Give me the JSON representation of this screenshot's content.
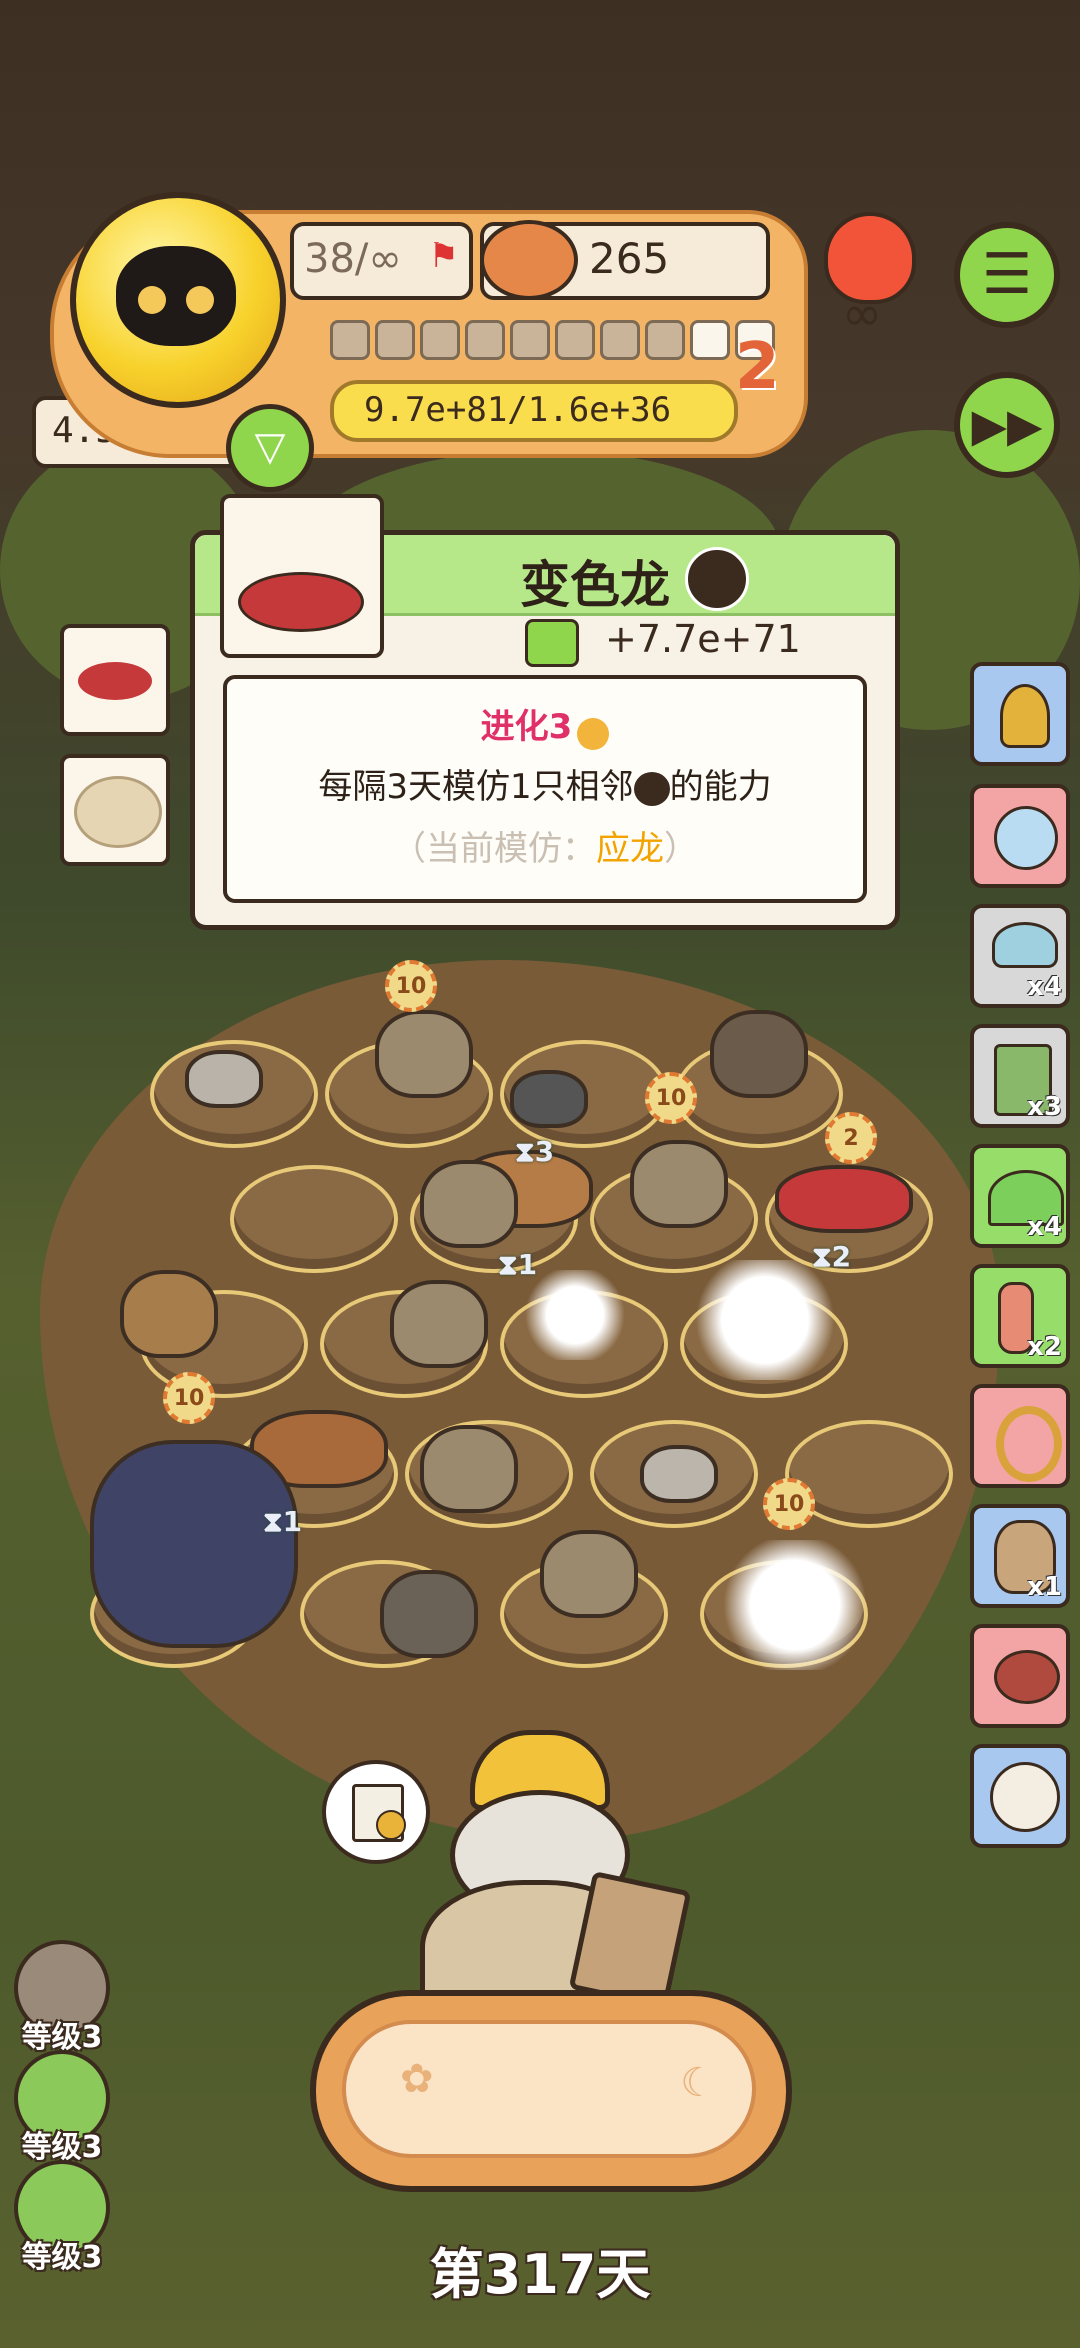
{
  "hud": {
    "moves": "38/∞",
    "food_count": "265",
    "level_number": "2",
    "progress_text": "9.7e+81/1.6e+36",
    "progress_segments_total": 10,
    "progress_segments_filled": 8,
    "score": "4.5e+80"
  },
  "popup": {
    "title": "变色龙",
    "bonus": "+7.7e+71",
    "evolution": "进化3",
    "description": "每隔3天模仿1只相邻",
    "description_suffix": "的能力",
    "current_prefix": "（当前模仿：",
    "current_value": "应龙",
    "current_suffix": "）"
  },
  "board_badges": [
    "10",
    "10",
    "2",
    "10",
    "10"
  ],
  "timers": [
    "3",
    "1",
    "2",
    "1"
  ],
  "side_items": [
    {
      "name": "trophy",
      "count": "",
      "color": "#a9c8f0"
    },
    {
      "name": "orb",
      "count": "",
      "color": "#f3a5a5"
    },
    {
      "name": "mushrooms",
      "count": "x4",
      "color": "#d8d8d8"
    },
    {
      "name": "card",
      "count": "x3",
      "color": "#d8d8d8"
    },
    {
      "name": "tent",
      "count": "x4",
      "color": "#97dd6a"
    },
    {
      "name": "worms",
      "count": "x2",
      "color": "#97dd6a"
    },
    {
      "name": "snake",
      "count": "",
      "color": "#f3a5a5"
    },
    {
      "name": "sack",
      "count": "x1",
      "color": "#a9c8f0"
    },
    {
      "name": "meat",
      "count": "",
      "color": "#f3a5a5"
    },
    {
      "name": "sheep",
      "count": "",
      "color": "#a9c8f0"
    }
  ],
  "levels": [
    {
      "label": "等级3",
      "color": "#9a8a7a"
    },
    {
      "label": "等级3",
      "color": "#8bc95a"
    },
    {
      "label": "等级3",
      "color": "#8bc95a"
    }
  ],
  "day_label": "第317天",
  "colors": {
    "accent_green": "#8fd64c",
    "panel_orange": "#f3b565",
    "title_pink": "#e0306a",
    "highlight_orange": "#f2a300"
  }
}
